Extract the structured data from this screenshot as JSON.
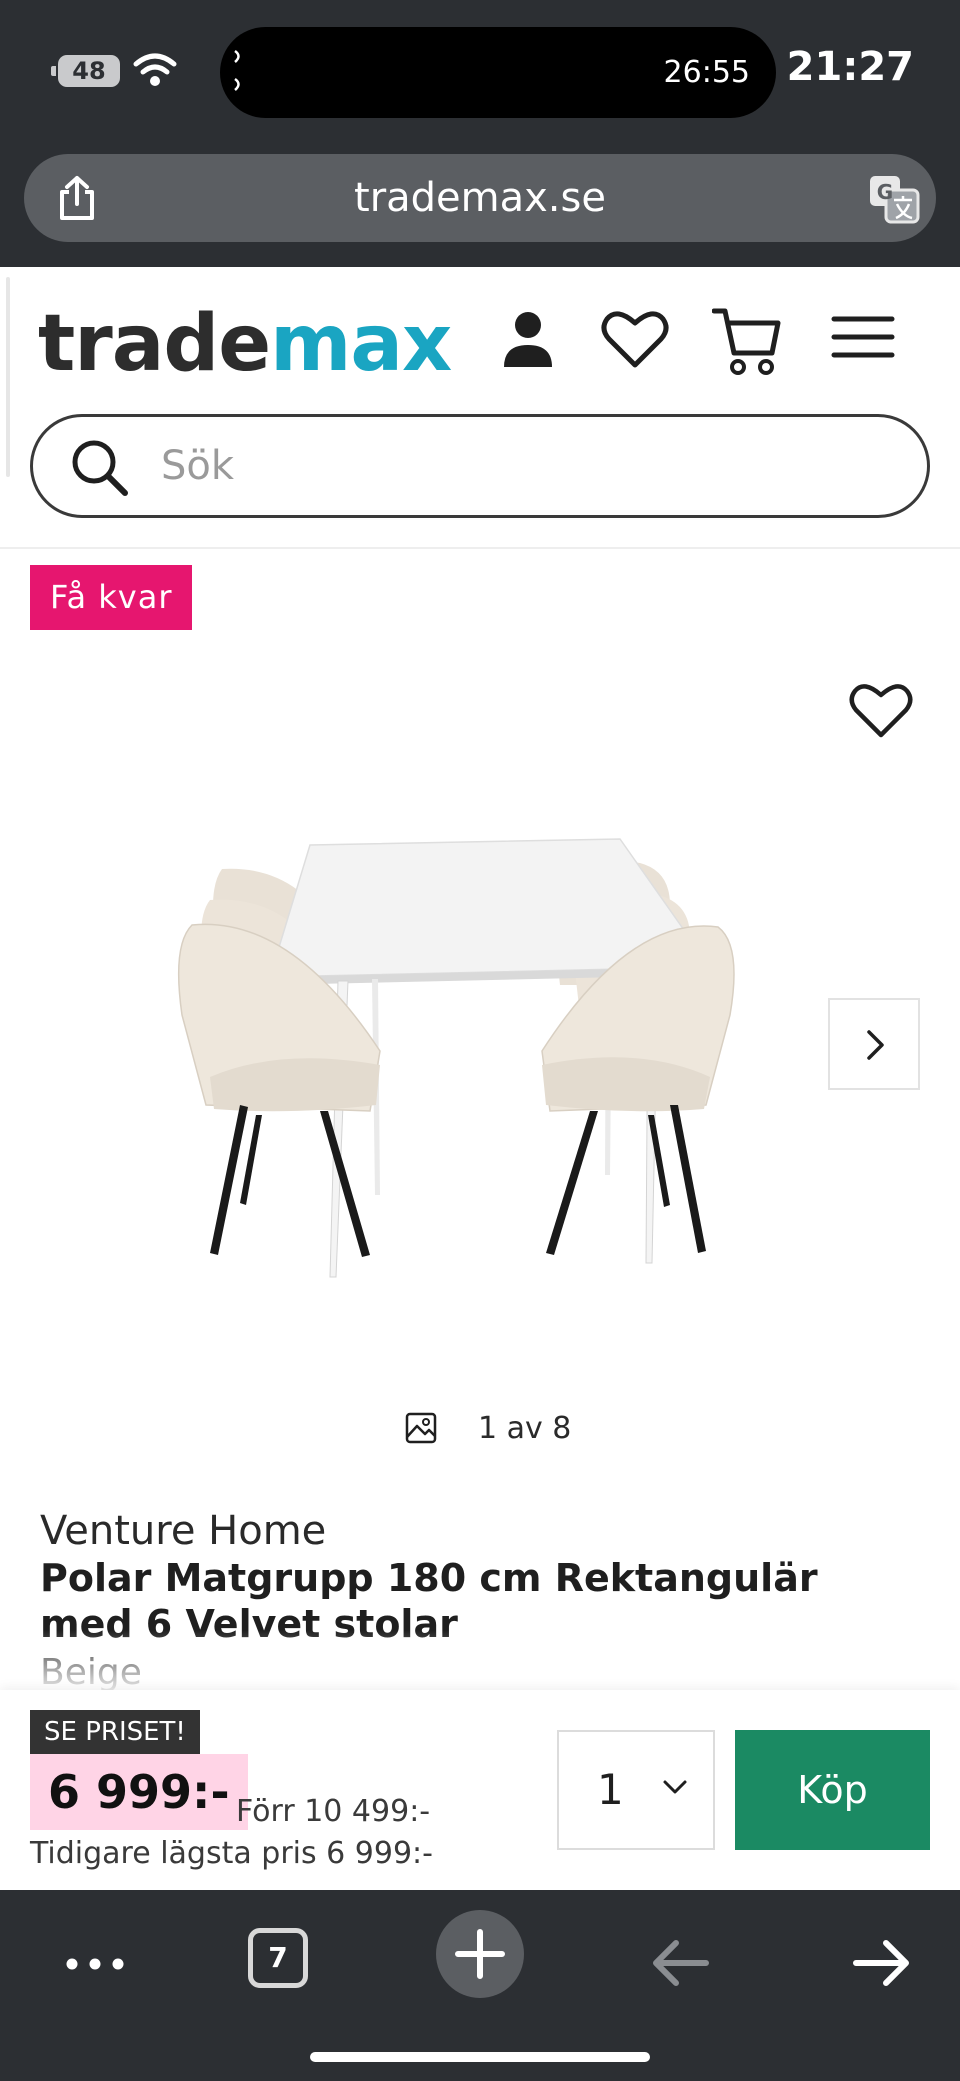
{
  "status_bar": {
    "battery": "48",
    "timer": "26:55",
    "time": "21:27"
  },
  "browser": {
    "url": "trademax.se",
    "tab_count": "7"
  },
  "site": {
    "logo_part1": "trade",
    "logo_part2": "max",
    "search_placeholder": "Sök",
    "brand_color": "#1aa5c2"
  },
  "product": {
    "badge": "Få kvar",
    "image_counter": "1 av 8",
    "brand": "Venture Home",
    "title": "Polar Matgrupp 180 cm Rektangulär med 6 Velvet stolar",
    "color": "Beige"
  },
  "buy_bar": {
    "promo_label": "SE PRISET!",
    "price": "6 999:-",
    "old_price": "Förr 10 499:-",
    "lowest_price": "Tidigare lägsta pris 6 999:-",
    "quantity": "1",
    "buy_label": "Köp",
    "buy_color": "#1b8a63",
    "price_highlight": "#ffd4e6"
  },
  "icons": [
    "wifi-icon",
    "share-icon",
    "translate-icon",
    "user-icon",
    "heart-icon",
    "cart-icon",
    "menu-icon",
    "search-icon",
    "chevron-right-icon",
    "gallery-icon",
    "chevron-down-icon",
    "more-icon",
    "plus-icon",
    "arrow-left-icon",
    "arrow-right-icon"
  ]
}
